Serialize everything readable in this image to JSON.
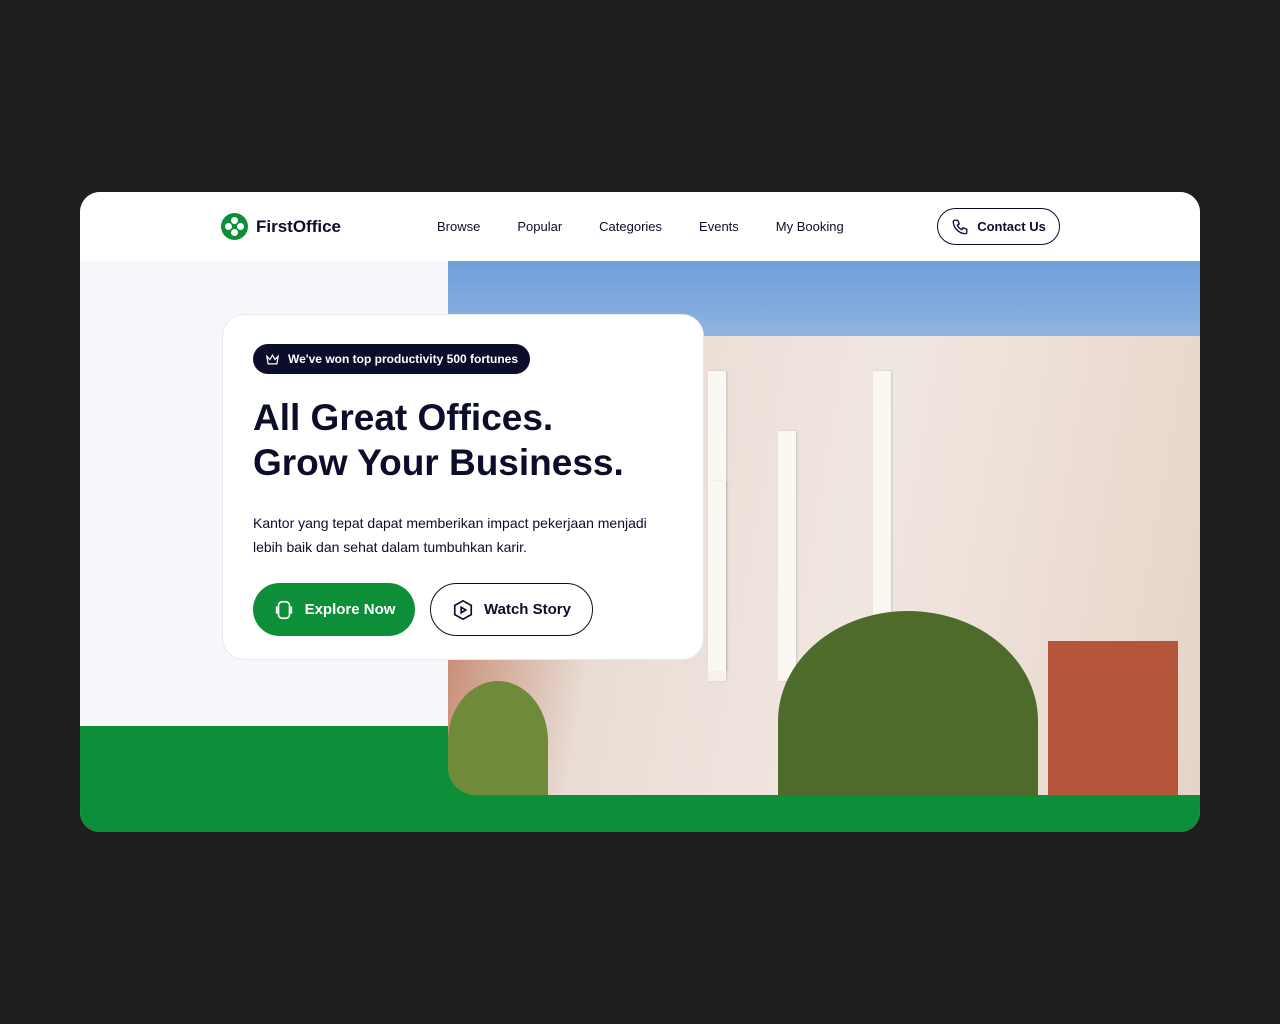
{
  "brand": {
    "name": "FirstOffice",
    "color": "#0d8f3a"
  },
  "nav": {
    "items": [
      "Browse",
      "Popular",
      "Categories",
      "Events",
      "My Booking"
    ],
    "contact_label": "Contact Us"
  },
  "hero": {
    "badge": "We've won top productivity 500 fortunes",
    "title_line1": "All Great Offices.",
    "title_line2": "Grow Your Business.",
    "description": "Kantor yang tepat dapat memberikan impact pekerjaan menjadi lebih baik dan sehat dalam tumbuhkan karir.",
    "primary_button": "Explore Now",
    "secondary_button": "Watch Story"
  }
}
